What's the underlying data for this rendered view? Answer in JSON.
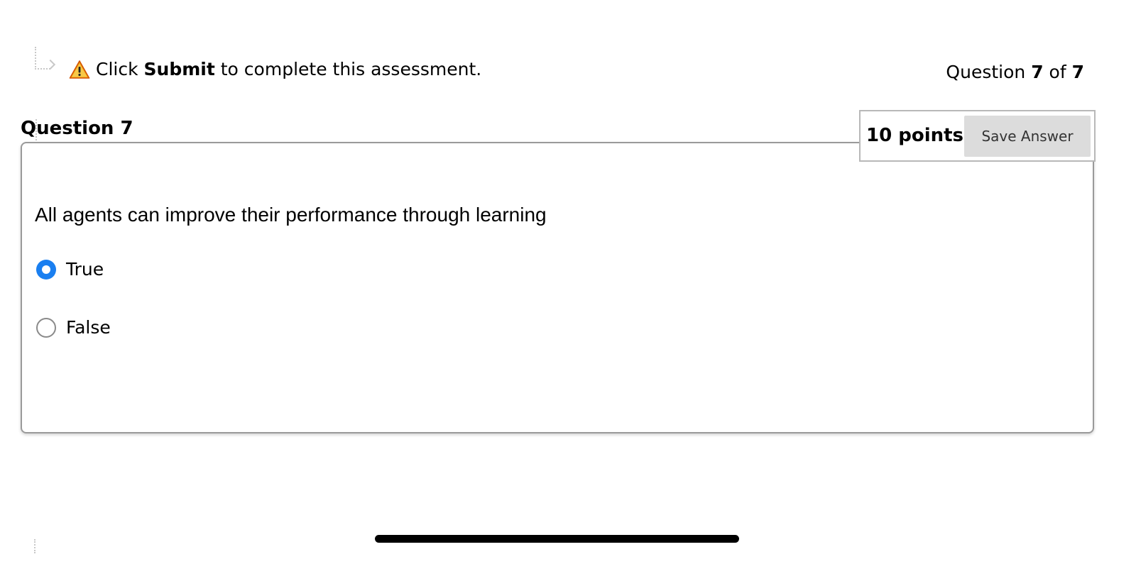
{
  "instruction": {
    "prefix": "Click ",
    "emphasis": "Submit",
    "suffix": " to complete this assessment.",
    "icon": "warning-icon"
  },
  "progress": {
    "prefix": "Question ",
    "current": "7",
    "middle": " of ",
    "total": "7"
  },
  "question": {
    "heading": "Question 7",
    "points": "10 points",
    "save_label": "Save Answer",
    "text": "All agents can improve their performance through learning",
    "options": [
      {
        "label": "True",
        "selected": true
      },
      {
        "label": "False",
        "selected": false
      }
    ]
  },
  "colors": {
    "radio_selected": "#1a7ff0",
    "warning_fill": "#f39c12",
    "button_bg": "#dcdcdc"
  }
}
